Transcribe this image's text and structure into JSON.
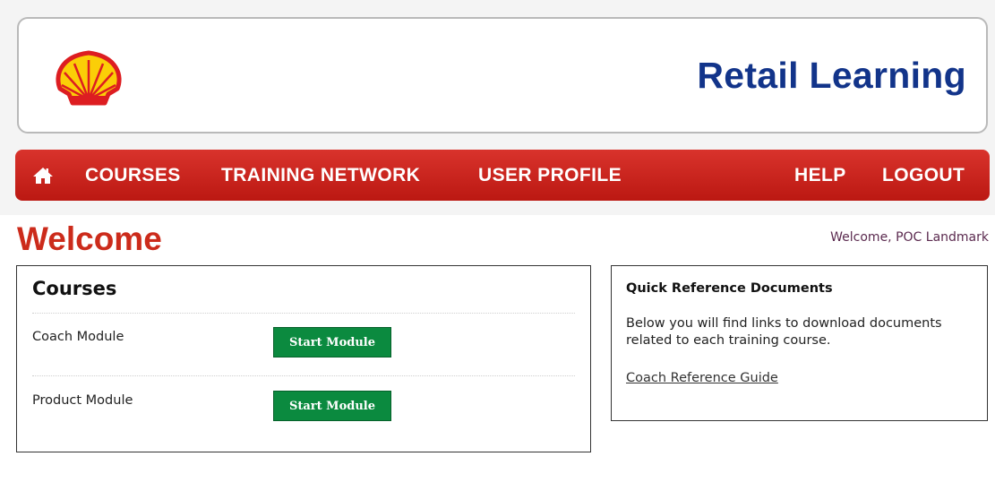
{
  "header": {
    "title": "Retail Learning",
    "logo_icon": "shell-pecten-logo"
  },
  "nav": {
    "home_icon": "home-icon",
    "items": [
      {
        "label": "COURSES"
      },
      {
        "label": "TRAINING NETWORK"
      },
      {
        "label": "USER PROFILE"
      },
      {
        "label": "HELP"
      },
      {
        "label": "LOGOUT"
      }
    ]
  },
  "welcome": {
    "heading": "Welcome",
    "user_greeting": "Welcome, POC Landmark"
  },
  "courses": {
    "title": "Courses",
    "modules": [
      {
        "name": "Coach Module",
        "button_label": "Start Module"
      },
      {
        "name": "Product Module",
        "button_label": "Start Module"
      }
    ]
  },
  "quick_reference": {
    "title": "Quick Reference Documents",
    "description": "Below you will find links to download documents related to each training course.",
    "links": [
      {
        "label": "Coach Reference Guide"
      }
    ]
  },
  "colors": {
    "brand_blue": "#12348a",
    "nav_red": "#c8211a",
    "welcome_red": "#cc2b1b",
    "button_green": "#0b8a3f"
  }
}
